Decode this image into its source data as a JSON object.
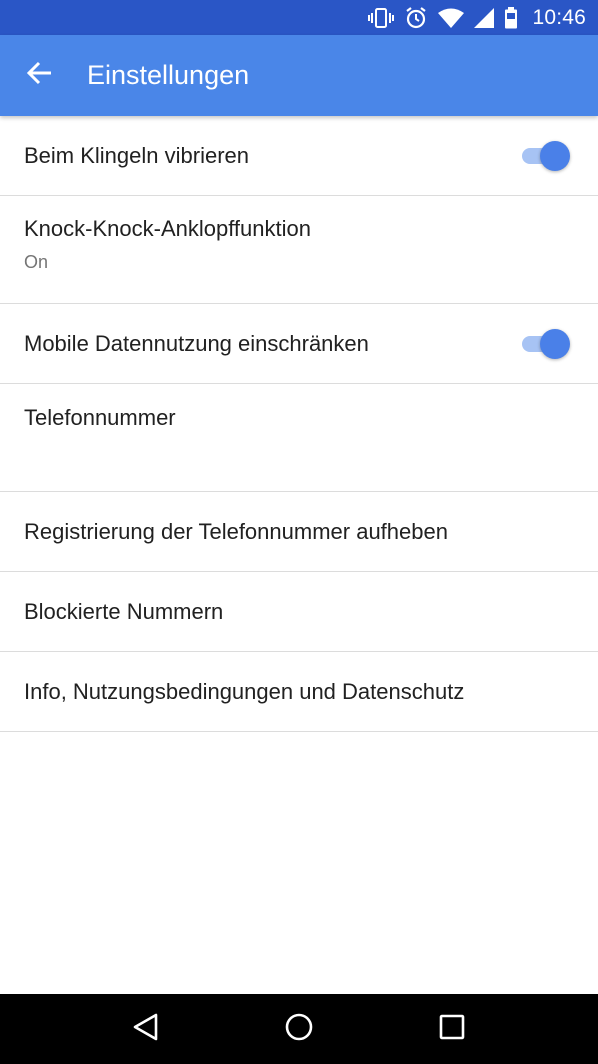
{
  "status_bar": {
    "time": "10:46",
    "icons": [
      "vibrate-icon",
      "alarm-icon",
      "wifi-icon",
      "signal-icon",
      "battery-icon"
    ]
  },
  "app_bar": {
    "back_icon": "arrow-back-icon",
    "title": "Einstellungen"
  },
  "settings": {
    "vibrate": {
      "title": "Beim Klingeln vibrieren",
      "enabled": true
    },
    "knock": {
      "title": "Knock-Knock-Anklopffunktion",
      "subtitle": "On"
    },
    "mobile_data": {
      "title": "Mobile Datennutzung einschränken",
      "enabled": true
    },
    "phone_number": {
      "title": "Telefonnummer",
      "subtitle": ""
    },
    "unregister": {
      "title": "Registrierung der Telefonnummer aufheben"
    },
    "blocked": {
      "title": "Blockierte Nummern"
    },
    "info": {
      "title": "Info, Nutzungsbedingungen und Datenschutz"
    }
  },
  "colors": {
    "status_bar": "#2a56c6",
    "app_bar": "#4a86e8",
    "toggle_thumb": "#4a80e8",
    "toggle_track": "#a7c3f4"
  },
  "nav_bar": {
    "icons": [
      "back-triangle-icon",
      "home-circle-icon",
      "recents-square-icon"
    ]
  }
}
